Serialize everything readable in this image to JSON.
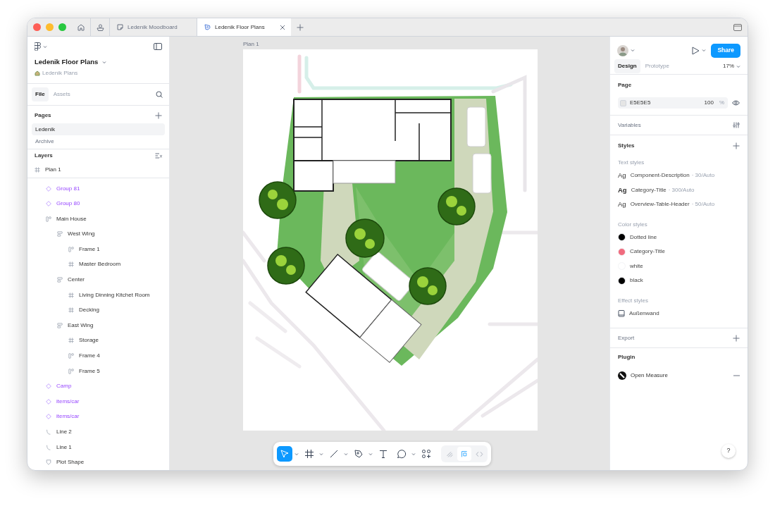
{
  "tabs": [
    {
      "kind": "home"
    },
    {
      "kind": "community"
    },
    {
      "kind": "board-file",
      "label": "Ledenik Moodboard",
      "selected": false
    },
    {
      "kind": "design-file",
      "label": "Ledenik Floor Plans",
      "selected": true
    }
  ],
  "file": {
    "name": "Ledenik Floor Plans",
    "project": "Ledenik Plans"
  },
  "panel_tabs": [
    {
      "label": "File",
      "selected": true
    },
    {
      "label": "Assets",
      "selected": false
    }
  ],
  "pages": {
    "title": "Pages",
    "items": [
      {
        "label": "Ledenik",
        "selected": true
      },
      {
        "label": "Archive",
        "selected": false
      }
    ]
  },
  "layers": {
    "title": "Layers",
    "root": {
      "label": "Plan 1",
      "kind": "frame"
    },
    "items": [
      {
        "label": "Group 81",
        "kind": "component"
      },
      {
        "label": "Group 80",
        "kind": "component"
      },
      {
        "label": "Main House",
        "kind": "autolayout",
        "children": [
          {
            "label": "West Wing",
            "kind": "section",
            "children": [
              {
                "label": "Frame 1",
                "kind": "autolayout"
              },
              {
                "label": "Master Bedroom",
                "kind": "frame"
              }
            ]
          },
          {
            "label": "Center",
            "kind": "section",
            "children": [
              {
                "label": "Living Dinning Kitchet Room",
                "kind": "frame"
              },
              {
                "label": "Decking",
                "kind": "frame"
              }
            ]
          },
          {
            "label": "East Wing",
            "kind": "section",
            "children": [
              {
                "label": "Storage",
                "kind": "frame"
              },
              {
                "label": "Frame 4",
                "kind": "autolayout"
              },
              {
                "label": "Frame 5",
                "kind": "autolayout"
              }
            ]
          }
        ]
      },
      {
        "label": "Camp",
        "kind": "component"
      },
      {
        "label": "items/car",
        "kind": "component"
      },
      {
        "label": "items/car",
        "kind": "component"
      },
      {
        "label": "Line 2",
        "kind": "line"
      },
      {
        "label": "Line 1",
        "kind": "line"
      },
      {
        "label": "Plot Shape",
        "kind": "shape"
      }
    ]
  },
  "canvas": {
    "frame_label": "Plan 1"
  },
  "toolbar": {
    "tools": [
      {
        "kind": "move",
        "selected": true,
        "caret": true
      },
      {
        "kind": "frame",
        "selected": false,
        "caret": true
      },
      {
        "kind": "line",
        "selected": false,
        "caret": true
      },
      {
        "kind": "pen",
        "selected": false,
        "caret": true
      },
      {
        "kind": "text",
        "selected": false,
        "caret": false
      },
      {
        "kind": "comment",
        "selected": false,
        "caret": true
      },
      {
        "kind": "actions",
        "selected": false,
        "caret": false
      }
    ],
    "modes": [
      {
        "kind": "draw",
        "selected": false
      },
      {
        "kind": "design",
        "selected": true
      },
      {
        "kind": "dev",
        "selected": false
      }
    ]
  },
  "right": {
    "share": "Share",
    "tabs": [
      {
        "label": "Design",
        "selected": true
      },
      {
        "label": "Prototype",
        "selected": false
      }
    ],
    "zoom": "17%",
    "page": {
      "title": "Page",
      "color": "#e5e5e5",
      "hex": "E5E5E5",
      "opacity": "100",
      "unit": "%"
    },
    "variables": "Variables",
    "styles": "Styles",
    "text_styles": {
      "title": "Text styles",
      "items": [
        {
          "sample": "Ag",
          "name": "Component-Description",
          "meta": "· 30/Auto",
          "bold": false
        },
        {
          "sample": "Ag",
          "name": "Category-Title",
          "meta": "· 300/Auto",
          "bold": true
        },
        {
          "sample": "Ag",
          "name": "Overview-Table-Header",
          "meta": "· 50/Auto",
          "bold": false
        }
      ]
    },
    "color_styles": {
      "title": "Color styles",
      "items": [
        {
          "name": "Dotted line",
          "color": "#000000"
        },
        {
          "name": "Category-Title",
          "color": "#f06b7e"
        },
        {
          "name": "white",
          "color": "#ffffff"
        },
        {
          "name": "black",
          "color": "#000000"
        }
      ]
    },
    "effect_styles": {
      "title": "Effect styles",
      "items": [
        {
          "name": "Außenwand"
        }
      ]
    },
    "export": "Export",
    "plugin": {
      "title": "Plugin",
      "items": [
        {
          "name": "Open Measure"
        }
      ]
    },
    "help": "?"
  }
}
